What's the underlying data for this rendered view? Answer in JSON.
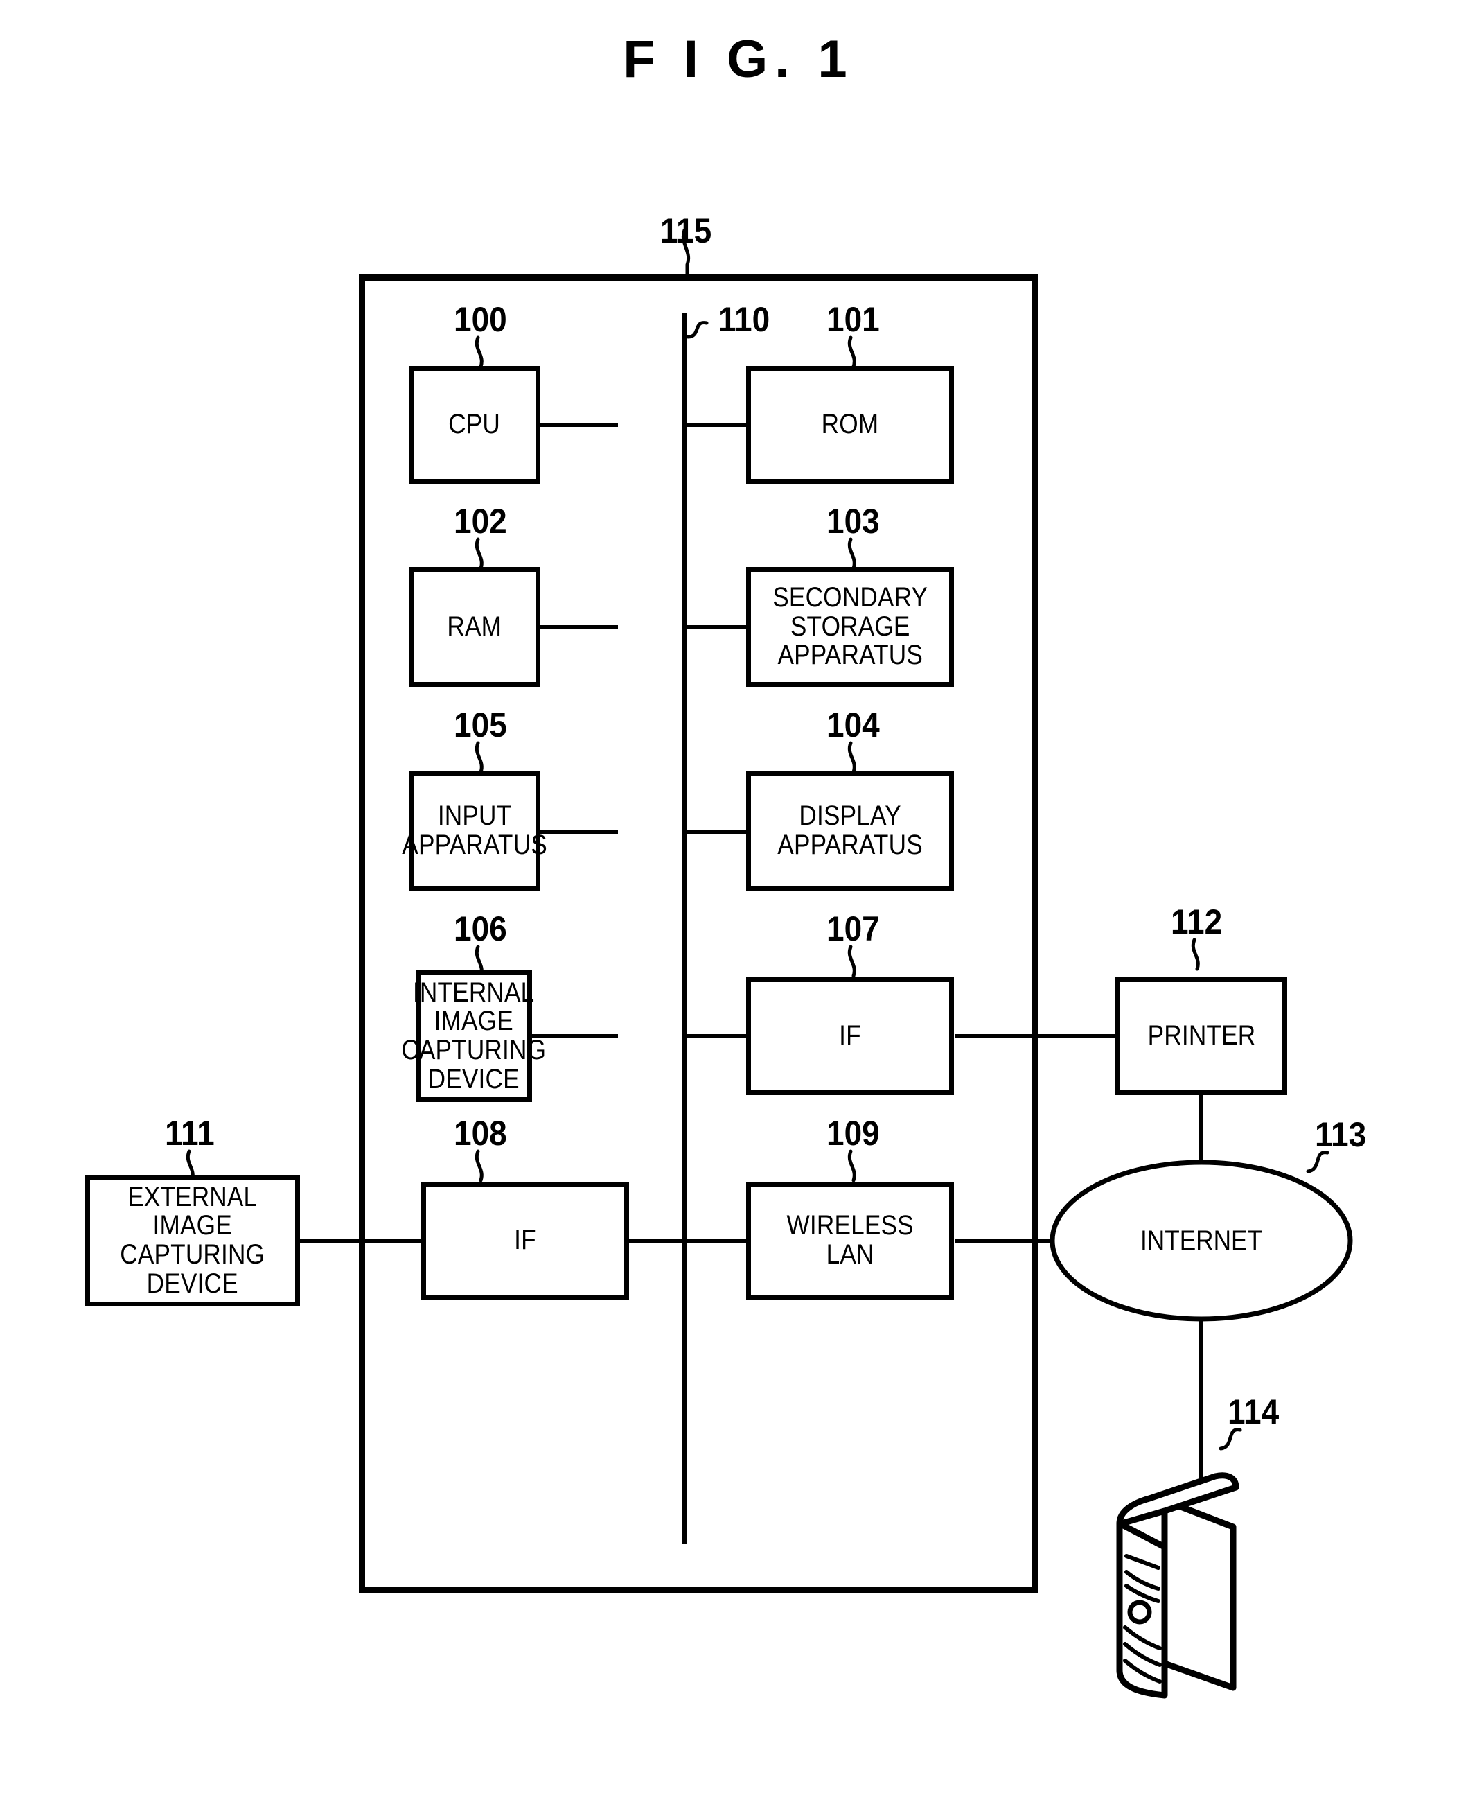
{
  "figure": {
    "title": "F I G.  1"
  },
  "system": {
    "ref": "115",
    "bus_ref": "110"
  },
  "blocks": [
    {
      "id": "cpu",
      "ref": "100",
      "label": "CPU"
    },
    {
      "id": "rom",
      "ref": "101",
      "label": "ROM"
    },
    {
      "id": "ram",
      "ref": "102",
      "label": "RAM"
    },
    {
      "id": "secondary-storage",
      "ref": "103",
      "label": "SECONDARY\nSTORAGE\nAPPARATUS"
    },
    {
      "id": "display-apparatus",
      "ref": "104",
      "label": "DISPLAY\nAPPARATUS"
    },
    {
      "id": "input-apparatus",
      "ref": "105",
      "label": "INPUT\nAPPARATUS"
    },
    {
      "id": "internal-image-device",
      "ref": "106",
      "label": "INTERNAL\nIMAGE\nCAPTURING\nDEVICE"
    },
    {
      "id": "if-printer",
      "ref": "107",
      "label": "IF"
    },
    {
      "id": "if-external",
      "ref": "108",
      "label": "IF"
    },
    {
      "id": "wireless-lan",
      "ref": "109",
      "label": "WIRELESS\nLAN"
    },
    {
      "id": "external-image-device",
      "ref": "111",
      "label": "EXTERNAL\nIMAGE\nCAPTURING\nDEVICE"
    },
    {
      "id": "printer",
      "ref": "112",
      "label": "PRINTER"
    },
    {
      "id": "internet",
      "ref": "113",
      "label": "INTERNET"
    },
    {
      "id": "server",
      "ref": "114",
      "label": ""
    }
  ],
  "colors": {
    "line": "#000000",
    "background": "#ffffff"
  }
}
